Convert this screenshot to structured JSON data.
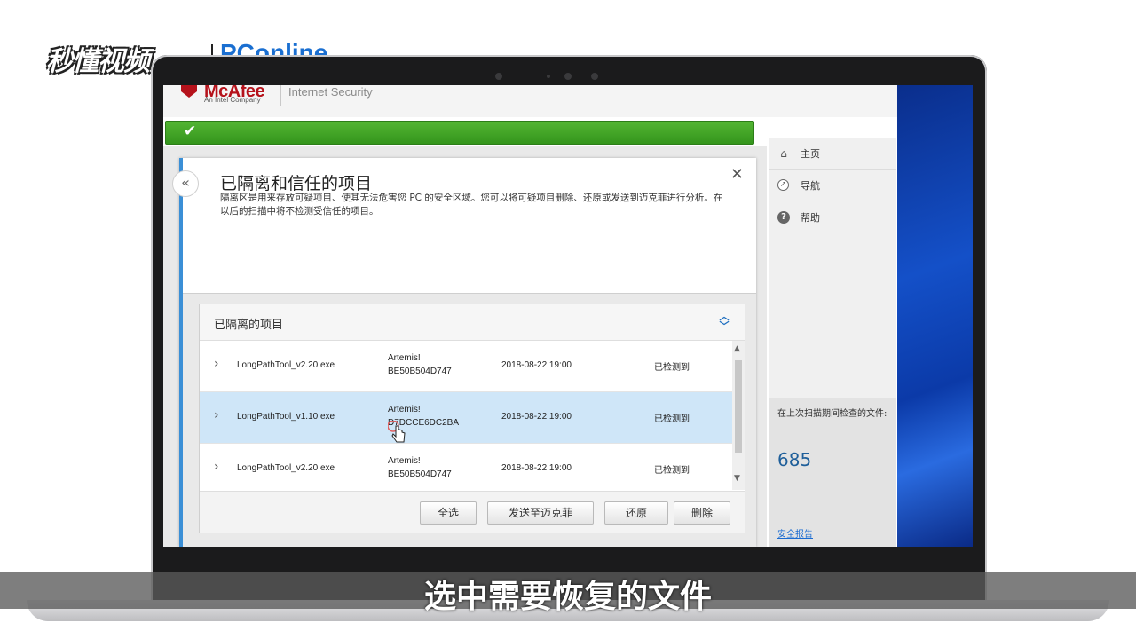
{
  "watermark": {
    "left": "秒懂视频",
    "right": "PConline"
  },
  "app": {
    "brand": "McAfee",
    "brand_tagline": "An Intel Company",
    "product": "Internet Security"
  },
  "side_menu": {
    "items": [
      {
        "label": "主页",
        "icon": "home-icon"
      },
      {
        "label": "导航",
        "icon": "compass-icon"
      },
      {
        "label": "帮助",
        "icon": "help-icon"
      }
    ],
    "stats_label": "在上次扫描期间检查的文件:",
    "stats_count": "685",
    "report_link": "安全报告"
  },
  "dialog": {
    "title": "已隔离和信任的项目",
    "description": "隔离区是用来存放可疑项目、使其无法危害您 PC 的安全区域。您可以将可疑项目删除、还原或发送到迈克菲进行分析。在以后的扫描中将不检测受信任的项目。",
    "section_title": "已隔离的项目",
    "rows": [
      {
        "file": "LongPathTool_v2.20.exe",
        "threat_line1": "Artemis!",
        "threat_line2": "BE50B504D747",
        "date": "2018-08-22 19:00",
        "status": "已检测到",
        "selected": false
      },
      {
        "file": "LongPathTool_v1.10.exe",
        "threat_line1": "Artemis!",
        "threat_line2": "D7DCCE6DC2BA",
        "date": "2018-08-22 19:00",
        "status": "已检测到",
        "selected": true
      },
      {
        "file": "LongPathTool_v2.20.exe",
        "threat_line1": "Artemis!",
        "threat_line2": "BE50B504D747",
        "date": "2018-08-22 19:00",
        "status": "已检测到",
        "selected": false
      }
    ],
    "buttons": {
      "select_all": "全选",
      "send": "发送至迈克菲",
      "restore": "还原",
      "delete": "删除"
    }
  },
  "subtitle": "选中需要恢复的文件",
  "colors": {
    "accent_blue": "#3b8fd6",
    "status_green": "#3ea322",
    "brand_red": "#b5121b"
  }
}
